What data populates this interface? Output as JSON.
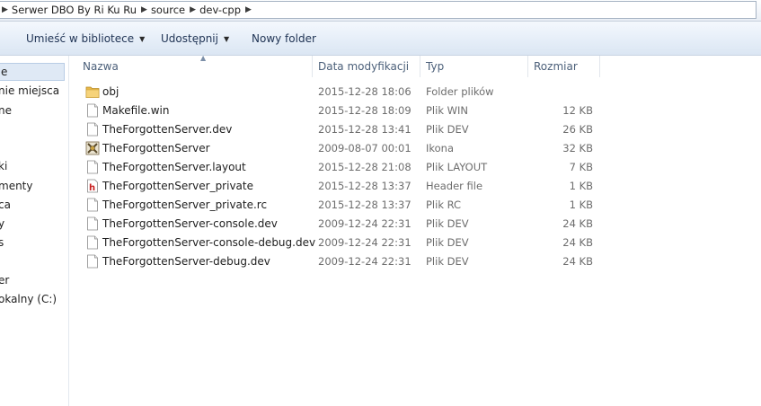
{
  "address": {
    "segments": [
      "Serwer DBO By Ri Ku Ru",
      "source",
      "dev-cpp"
    ]
  },
  "toolbar": {
    "library_label": "Umieść w bibliotece",
    "share_label": "Udostępnij",
    "new_folder_label": "Nowy folder"
  },
  "nav": {
    "items": [
      "e",
      "nie miejsca",
      "ne",
      "ki",
      "menty",
      "ca",
      "y",
      "s",
      "er",
      "okalny (C:)"
    ]
  },
  "columns": {
    "name": "Nazwa",
    "date": "Data modyfikacji",
    "type": "Typ",
    "size": "Rozmiar"
  },
  "files": [
    {
      "name": "obj",
      "date": "2015-12-28 18:06",
      "type": "Folder plików",
      "size": "",
      "icon": "folder-icon"
    },
    {
      "name": "Makefile.win",
      "date": "2015-12-28 18:09",
      "type": "Plik WIN",
      "size": "12 KB",
      "icon": "file-icon"
    },
    {
      "name": "TheForgottenServer.dev",
      "date": "2015-12-28 13:41",
      "type": "Plik DEV",
      "size": "26 KB",
      "icon": "file-icon"
    },
    {
      "name": "TheForgottenServer",
      "date": "2009-08-07 00:01",
      "type": "Ikona",
      "size": "32 KB",
      "icon": "app-icon"
    },
    {
      "name": "TheForgottenServer.layout",
      "date": "2015-12-28 21:08",
      "type": "Plik LAYOUT",
      "size": "7 KB",
      "icon": "file-icon"
    },
    {
      "name": "TheForgottenServer_private",
      "date": "2015-12-28 13:37",
      "type": "Header file",
      "size": "1 KB",
      "icon": "header-file-icon"
    },
    {
      "name": "TheForgottenServer_private.rc",
      "date": "2015-12-28 13:37",
      "type": "Plik RC",
      "size": "1 KB",
      "icon": "file-icon"
    },
    {
      "name": "TheForgottenServer-console.dev",
      "date": "2009-12-24 22:31",
      "type": "Plik DEV",
      "size": "24 KB",
      "icon": "file-icon"
    },
    {
      "name": "TheForgottenServer-console-debug.dev",
      "date": "2009-12-24 22:31",
      "type": "Plik DEV",
      "size": "24 KB",
      "icon": "file-icon"
    },
    {
      "name": "TheForgottenServer-debug.dev",
      "date": "2009-12-24 22:31",
      "type": "Plik DEV",
      "size": "24 KB",
      "icon": "file-icon"
    }
  ]
}
